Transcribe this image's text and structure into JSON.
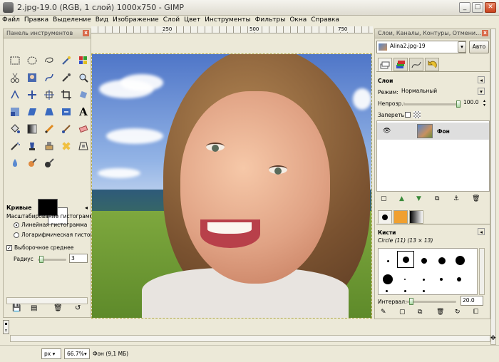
{
  "window": {
    "title": "2.jpg-19.0 (RGB, 1 слой) 1000x750 - GIMP",
    "controls": [
      "_",
      "□",
      "✕"
    ]
  },
  "menu": [
    "Файл",
    "Правка",
    "Выделение",
    "Вид",
    "Изображение",
    "Слой",
    "Цвет",
    "Инструменты",
    "Фильтры",
    "Окна",
    "Справка"
  ],
  "ruler": {
    "marks": [
      "250",
      "500",
      "750"
    ]
  },
  "toolbox": {
    "title": "Панель инструментов",
    "tool_options": {
      "title": "Кривые",
      "histogram_label": "Масштабирование гистограммы",
      "linear": "Линейная гистограмма",
      "log": "Логарифмическая гистограм",
      "sample_average": "Выборочное среднее",
      "radius_label": "Радиус",
      "radius_value": "3"
    }
  },
  "dock": {
    "header": "Слои, Каналы, Контуры, Отмени...",
    "image_select": "Alina2.jpg-19",
    "auto_button": "Авто",
    "layers": {
      "title": "Слои",
      "mode_label": "Режим:",
      "mode_value": "Нормальный",
      "opacity_label": "Непрозр.:",
      "opacity_value": "100.0",
      "lock_label": "Запереть:",
      "layer_name": "Фон"
    },
    "brushes": {
      "title": "Кисти",
      "subtitle": "Circle (11) (13 × 13)",
      "spacing_label": "Интервал:",
      "spacing_value": "20.0"
    }
  },
  "status": {
    "unit": "px",
    "zoom": "66.7%",
    "info": "Фон (9,1 МБ)"
  }
}
